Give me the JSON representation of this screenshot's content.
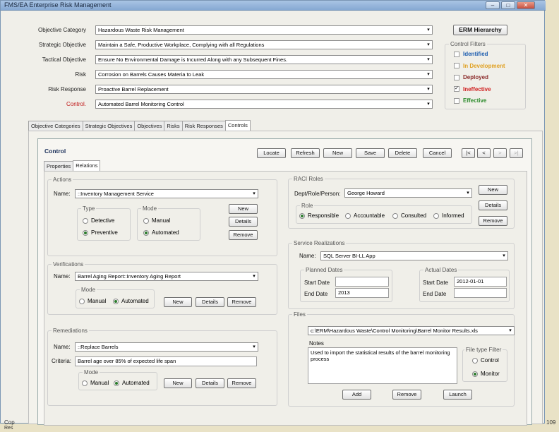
{
  "window": {
    "title": "FMS/EA Enterprise Risk Management"
  },
  "header": {
    "rows": [
      {
        "label": "Objective Category",
        "value": "Hazardous Waste Risk Management"
      },
      {
        "label": "Strategic Objective",
        "value": "Maintain a Safe, Productive Workplace, Complying with all Regulations"
      },
      {
        "label": "Tactical Objective",
        "value": "Ensure No Environmental Damage is Incurred Along with any Subsequent Fines."
      },
      {
        "label": "Risk",
        "value": "Corrosion on Barrels Causes Materia to Leak"
      },
      {
        "label": "Risk Response",
        "value": "Proactive Barrel Replacement"
      },
      {
        "label": "Control.",
        "value": "Automated Barrel Monitoring Control"
      }
    ],
    "erm_button": "ERM Hierarchy",
    "filters": {
      "title": "Control Filters",
      "items": [
        {
          "label": "Identified",
          "color": "#1f5fb0",
          "checked": false
        },
        {
          "label": "In Development",
          "color": "#e0a020",
          "checked": false
        },
        {
          "label": "Deployed",
          "color": "#8a2a2a",
          "checked": false
        },
        {
          "label": "Ineffective",
          "color": "#d02020",
          "checked": true
        },
        {
          "label": "Effective",
          "color": "#2a8a2a",
          "checked": false
        }
      ]
    }
  },
  "main_tabs": [
    "Objective Categories",
    "Strategic Objectives",
    "Objectives",
    "Risks",
    "Risk Responses",
    "Controls"
  ],
  "control": {
    "title": "Control",
    "toolbar": [
      "Locate",
      "Refresh",
      "New",
      "Save",
      "Delete",
      "Cancel"
    ],
    "nav": [
      "|<",
      "<",
      ">",
      ">|"
    ],
    "sub_tabs": [
      "Properties",
      "Relations"
    ]
  },
  "actions": {
    "title": "Actions",
    "name_label": "Name:",
    "name_value": "::Inventory Management Service",
    "type_title": "Type",
    "type_options": [
      "Detective",
      "Preventive"
    ],
    "mode_title": "Mode",
    "mode_options": [
      "Manual",
      "Automated"
    ],
    "buttons": [
      "New",
      "Details",
      "Remove"
    ]
  },
  "verifications": {
    "title": "Verifications",
    "name_label": "Name:",
    "name_value": "Barrel Aging Report::Inventory Aging Report",
    "mode_title": "Mode",
    "mode_options": [
      "Manual",
      "Automated"
    ],
    "buttons": [
      "New",
      "Details",
      "Remove"
    ]
  },
  "remediations": {
    "title": "Remediations",
    "name_label": "Name:",
    "name_value": "::Replace Barrels",
    "criteria_label": "Criteria:",
    "criteria_value": "Barrel age over 85% of expected life span",
    "mode_title": "Mode",
    "mode_options": [
      "Manual",
      "Automated"
    ],
    "buttons": [
      "New",
      "Details",
      "Remove"
    ]
  },
  "raci": {
    "title": "RACI Roles",
    "dept_label": "Dept/Role/Person:",
    "dept_value": "George Howard",
    "role_title": "Role",
    "role_options": [
      "Responsible",
      "Accountable",
      "Consulted",
      "Informed"
    ],
    "buttons": [
      "New",
      "Details",
      "Remove"
    ]
  },
  "service": {
    "title": "Service Realizations",
    "name_label": "Name:",
    "name_value": "SQL Server BI-LL App",
    "planned_title": "Planned Dates",
    "actual_title": "Actual Dates",
    "start_label": "Start Date",
    "end_label": "End Date",
    "planned_start": "",
    "planned_end": "2013",
    "actual_start": "2012-01-01",
    "actual_end": ""
  },
  "files": {
    "title": "Files",
    "path": "c:\\ERM\\Hazardous Waste\\Control Monitoring\\Barrel Monitor Results.xls",
    "notes_label": "Notes",
    "notes": "Used to import the statistical results of the barrel monitoring process",
    "filter_title": "File type Filter",
    "filter_options": [
      "Control",
      "Monitor"
    ],
    "buttons": [
      "Add",
      "Remove",
      "Launch"
    ]
  },
  "footer": {
    "left1": "Cop",
    "left2": "Res",
    "page": "109"
  }
}
